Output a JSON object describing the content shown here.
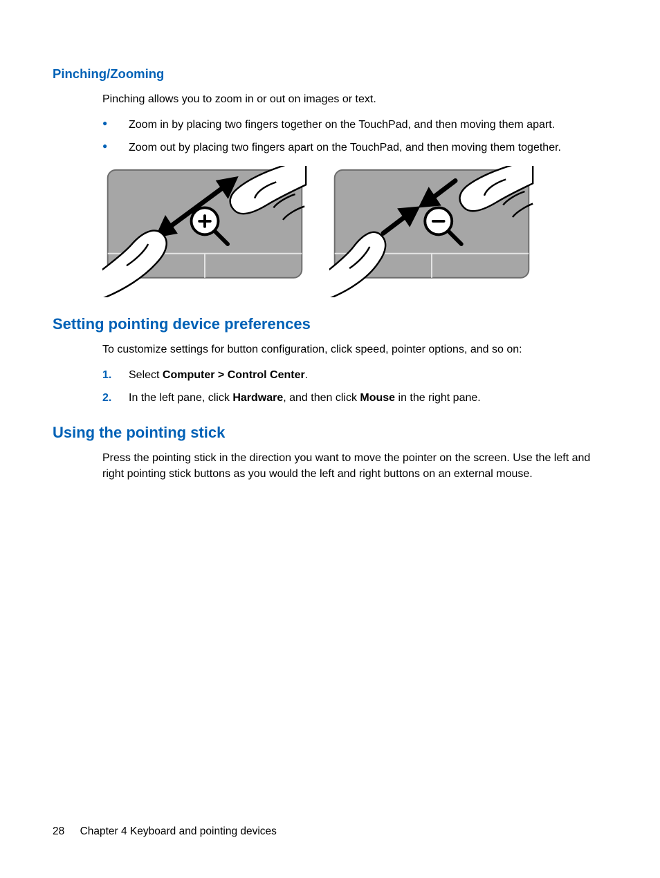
{
  "sections": {
    "pinching": {
      "heading": "Pinching/Zooming",
      "intro": "Pinching allows you to zoom in or out on images or text.",
      "bullets": [
        "Zoom in by placing two fingers together on the TouchPad, and then moving them apart.",
        "Zoom out by placing two fingers apart on the TouchPad, and then moving them together."
      ]
    },
    "setting": {
      "heading": "Setting pointing device preferences",
      "intro": "To customize settings for button configuration, click speed, pointer options, and so on:",
      "steps": [
        {
          "num": "1.",
          "pre": "Select ",
          "bold1": "Computer > Control Center",
          "post": "."
        },
        {
          "num": "2.",
          "pre": "In the left pane, click ",
          "bold1": "Hardware",
          "mid": ", and then click ",
          "bold2": "Mouse",
          "post": " in the right pane."
        }
      ]
    },
    "stick": {
      "heading": "Using the pointing stick",
      "intro": "Press the pointing stick in the direction you want to move the pointer on the screen. Use the left and right pointing stick buttons as you would the left and right buttons on an external mouse."
    }
  },
  "footer": {
    "page_number": "28",
    "chapter": "Chapter 4   Keyboard and pointing devices"
  }
}
